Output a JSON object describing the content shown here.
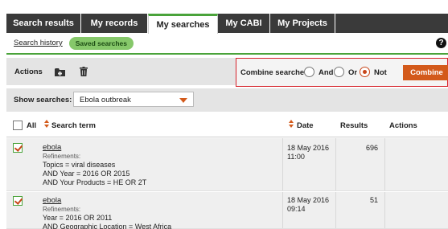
{
  "tabs": [
    {
      "label": "Search results",
      "active": false
    },
    {
      "label": "My records",
      "active": false
    },
    {
      "label": "My searches",
      "active": true
    },
    {
      "label": "My CABI",
      "active": false
    },
    {
      "label": "My Projects",
      "active": false
    }
  ],
  "subnav": {
    "history_link": "Search history",
    "saved_pill": "Saved searches",
    "help_icon": "?"
  },
  "actions": {
    "label": "Actions",
    "icons": [
      "folder-add-icon",
      "trash-icon"
    ]
  },
  "combine": {
    "label": "Combine searches",
    "options": [
      "And",
      "Or",
      "Not"
    ],
    "selected": "Not",
    "button": "Combine"
  },
  "show": {
    "label": "Show searches:",
    "value": "Ebola outbreak"
  },
  "table": {
    "headers": {
      "all": "All",
      "term": "Search term",
      "date": "Date",
      "results": "Results",
      "actions": "Actions"
    },
    "rows": [
      {
        "checked": true,
        "term": "ebola",
        "refinements_label": "Refinements:",
        "refinements": [
          "Topics = viral diseases",
          "AND Year = 2016 OR 2015",
          "AND Your Products = HE OR 2T"
        ],
        "date": "18 May 2016",
        "time": "11:00",
        "results": "696"
      },
      {
        "checked": true,
        "term": "ebola",
        "refinements_label": "Refinements:",
        "refinements": [
          "Year = 2016 OR 2011",
          "AND Geographic Location = West Africa"
        ],
        "date": "18 May 2016",
        "time": "09:14",
        "results": "51"
      }
    ]
  },
  "colors": {
    "tab_dark": "#3a3a3a",
    "accent_green": "#4aa33a",
    "accent_orange": "#d35a1b",
    "highlight_red": "#d6222b"
  }
}
